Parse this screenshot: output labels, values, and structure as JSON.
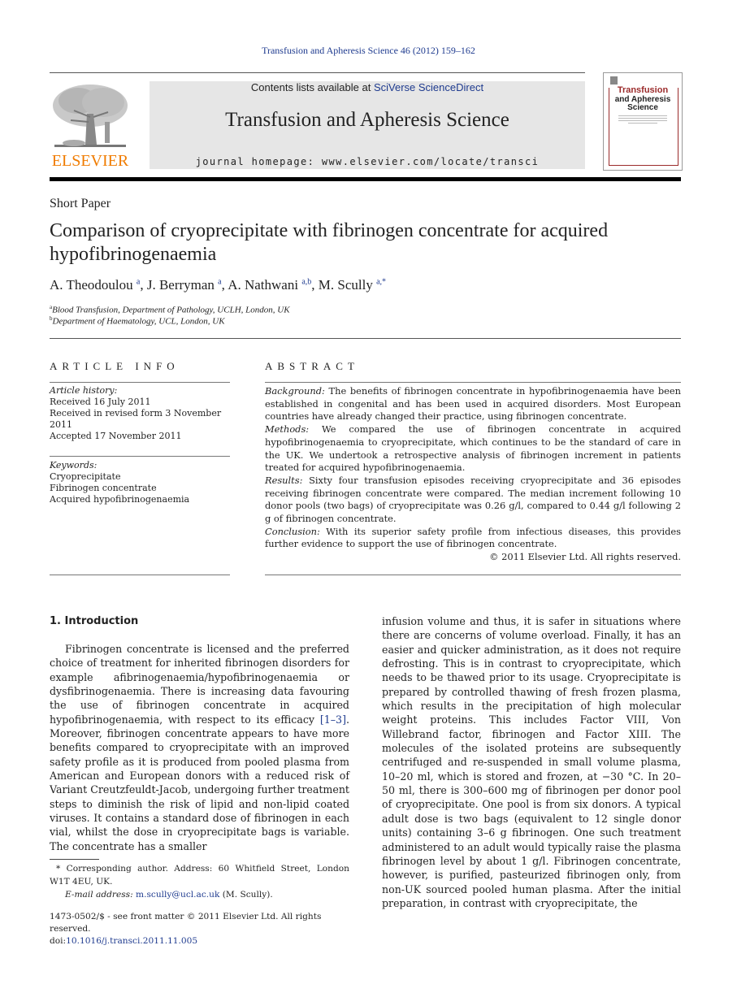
{
  "header": {
    "journal_reference": "Transfusion and Apheresis Science 46 (2012) 159–162",
    "publisher_logo_text": "ELSEVIER",
    "contents_prefix": "Contents lists available at ",
    "contents_link": "SciVerse ScienceDirect",
    "journal_title": "Transfusion and Apheresis Science",
    "homepage": "journal homepage: www.elsevier.com/locate/transci",
    "cover": {
      "title_line1": "Transfusion",
      "title_line2": "and Apheresis",
      "title_line3": "Science"
    }
  },
  "article": {
    "type": "Short Paper",
    "title": "Comparison of cryoprecipitate with fibrinogen concentrate for acquired hypofibrinogenaemia",
    "authors": [
      {
        "name": "A. Theodoulou",
        "affil": "a"
      },
      {
        "name": "J. Berryman",
        "affil": "a"
      },
      {
        "name": "A. Nathwani",
        "affil": "a,b"
      },
      {
        "name": "M. Scully",
        "affil": "a,*"
      }
    ],
    "affiliations": [
      {
        "mark": "a",
        "text": "Blood Transfusion, Department of Pathology, UCLH, London, UK"
      },
      {
        "mark": "b",
        "text": "Department of Haematology, UCL, London, UK"
      }
    ]
  },
  "article_info": {
    "heading": "ARTICLE INFO",
    "history_label": "Article history:",
    "history": [
      "Received 16 July 2011",
      "Received in revised form 3 November 2011",
      "Accepted 17 November 2011"
    ],
    "keywords_label": "Keywords:",
    "keywords": [
      "Cryoprecipitate",
      "Fibrinogen concentrate",
      "Acquired hypofibrinogenaemia"
    ]
  },
  "abstract": {
    "heading": "ABSTRACT",
    "sections": [
      {
        "label": "Background:",
        "text": " The benefits of fibrinogen concentrate in hypofibrinogenaemia have been established in congenital and has been used in acquired disorders. Most European countries have already changed their practice, using fibrinogen concentrate."
      },
      {
        "label": "Methods:",
        "text": " We compared the use of fibrinogen concentrate in acquired hypofibrinogenaemia to cryoprecipitate, which continues to be the standard of care in the UK. We undertook a retrospective analysis of fibrinogen increment in patients treated for acquired hypofibrinogenaemia."
      },
      {
        "label": "Results:",
        "text": " Sixty four transfusion episodes receiving cryoprecipitate and 36 episodes receiving fibrinogen concentrate were compared. The median increment following 10 donor pools (two bags) of cryoprecipitate was 0.26 g/l, compared to 0.44 g/l following 2 g of fibrinogen concentrate."
      },
      {
        "label": "Conclusion:",
        "text": " With its superior safety profile from infectious diseases, this provides further evidence to support the use of fibrinogen concentrate."
      }
    ],
    "copyright": "© 2011 Elsevier Ltd. All rights reserved."
  },
  "body": {
    "intro_heading": "1. Introduction",
    "left_para_before_ref": "Fibrinogen concentrate is licensed and the preferred choice of treatment for inherited fibrinogen disorders for example afibrinogenaemia/hypofibrinogenaemia or dysfibrinogenaemia. There is increasing data favouring the use of fibrinogen concentrate in acquired hypofibrinogenaemia, with respect to its efficacy ",
    "left_ref": "[1–3]",
    "left_para_after_ref": ". Moreover, fibrinogen concentrate appears to have more benefits compared to cryoprecipitate with an improved safety profile as it is produced from pooled plasma from American and European donors with a reduced risk of Variant Creutzfeuldt-Jacob, undergoing further treatment steps to diminish the risk of lipid and non-lipid coated viruses. It contains a standard dose of fibrinogen in each vial, whilst the dose in cryoprecipitate bags is variable. The concentrate has a smaller",
    "right_para": "infusion volume and thus, it is safer in situations where there are concerns of volume overload. Finally, it has an easier and quicker administration, as it does not require defrosting. This is in contrast to cryoprecipitate, which needs to be thawed prior to its usage. Cryoprecipitate is prepared by controlled thawing of fresh frozen plasma, which results in the precipitation of high molecular weight proteins. This includes Factor VIII, Von Willebrand factor, fibrinogen and Factor XIII. The molecules of the isolated proteins are subsequently centrifuged and re-suspended in small volume plasma, 10–20 ml, which is stored and frozen, at −30 °C. In 20–50 ml, there is 300–600 mg of fibrinogen per donor pool of cryoprecipitate. One pool is from six donors. A typical adult dose is two bags (equivalent to 12 single donor units) containing 3–6 g fibrinogen. One such treatment administered to an adult would typically raise the plasma fibrinogen level by about 1 g/l. Fibrinogen concentrate, however, is purified, pasteurized fibrinogen only, from non-UK sourced pooled human plasma. After the initial preparation, in contrast with cryoprecipitate, the"
  },
  "footnotes": {
    "corresponding": "* Corresponding author. Address: 60 Whitfield Street, London W1T 4EU, UK.",
    "email_label": "E-mail address:",
    "email": "m.scully@ucl.ac.uk",
    "email_suffix": " (M. Scully).",
    "issn_line": "1473-0502/$ - see front matter © 2011 Elsevier Ltd. All rights reserved.",
    "doi_prefix": "doi:",
    "doi": "10.1016/j.transci.2011.11.005"
  }
}
